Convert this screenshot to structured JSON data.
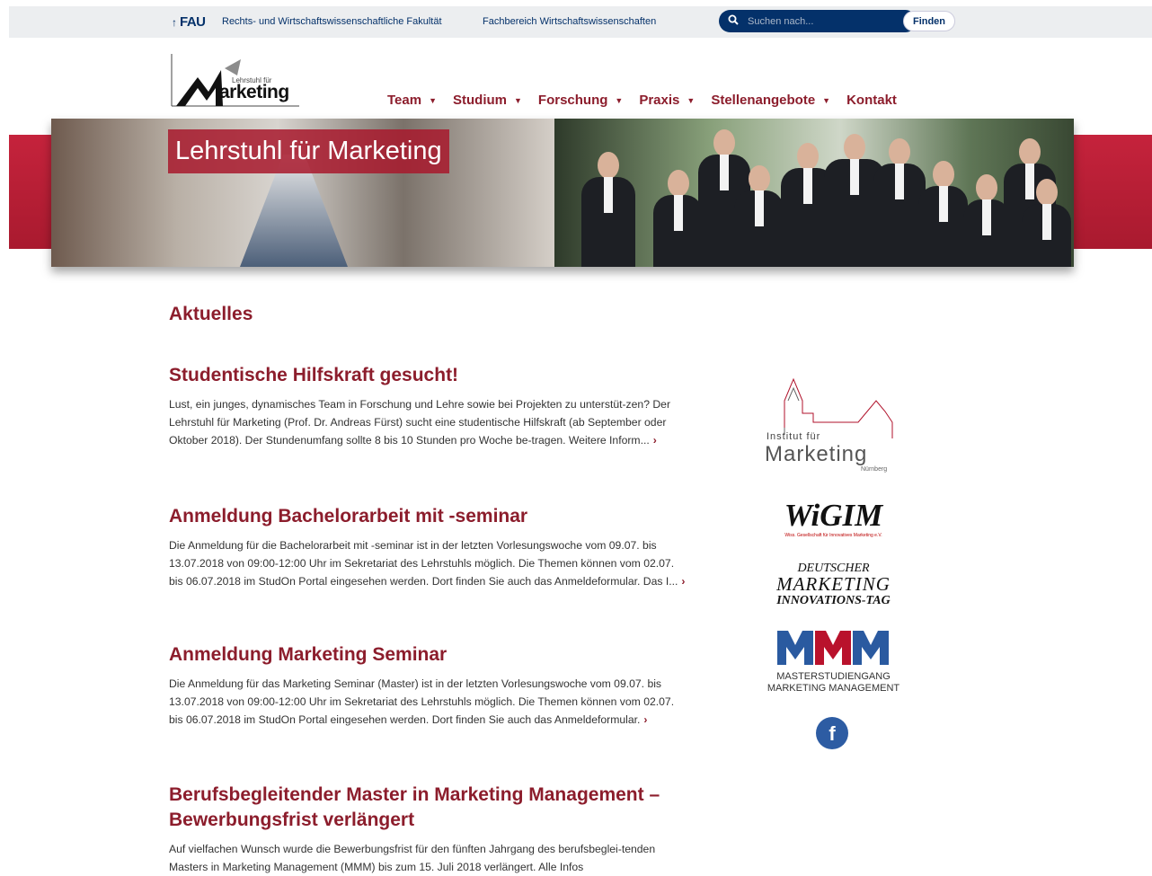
{
  "topbar": {
    "fau_arrow": "↑",
    "fau_label": "FAU",
    "crumb_faculty": "Rechts- und Wirtschaftswissenschaftliche Fakultät",
    "crumb_department": "Fachbereich Wirtschaftswissenschaften",
    "search_placeholder": "Suchen nach...",
    "search_button": "Finden"
  },
  "logo": {
    "line1": "Lehrstuhl für",
    "line2": "arketing"
  },
  "nav": {
    "items": [
      {
        "label": "Team",
        "dropdown": true
      },
      {
        "label": "Studium",
        "dropdown": true
      },
      {
        "label": "Forschung",
        "dropdown": true
      },
      {
        "label": "Praxis",
        "dropdown": true
      },
      {
        "label": "Stellenangebote",
        "dropdown": true
      },
      {
        "label": "Kontakt",
        "dropdown": false
      }
    ],
    "caret": "▼"
  },
  "hero": {
    "title": "Lehrstuhl für Marketing"
  },
  "main": {
    "section_title": "Aktuelles",
    "articles": [
      {
        "title": "Studentische Hilfskraft gesucht!",
        "text": "Lust, ein junges, dynamisches Team in Forschung und Lehre sowie bei Projekten zu unterstüt-zen? Der Lehrstuhl für Marketing (Prof. Dr. Andreas Fürst) sucht eine studentische Hilfskraft (ab September oder Oktober 2018). Der Stundenumfang sollte 8 bis 10 Stunden pro Woche be-tragen. Weitere Inform...",
        "more": "›"
      },
      {
        "title": "Anmeldung Bachelorarbeit mit -seminar",
        "text": "Die Anmeldung für die Bachelorarbeit mit -seminar ist in der letzten Vorlesungswoche vom 09.07. bis 13.07.2018 von 09:00-12:00 Uhr im Sekretariat des Lehrstuhls möglich. Die Themen können vom 02.07. bis 06.07.2018 im StudOn Portal eingesehen werden. Dort finden Sie auch das Anmeldeformular. Das I...",
        "more": "›"
      },
      {
        "title": "Anmeldung Marketing Seminar",
        "text": "Die Anmeldung für das Marketing Seminar (Master) ist in der letzten Vorlesungswoche vom 09.07. bis 13.07.2018 von 09:00-12:00 Uhr im Sekretariat des Lehrstuhls möglich. Die Themen können vom 02.07. bis 06.07.2018 im StudOn Portal eingesehen werden. Dort finden Sie auch das Anmeldeformular.",
        "more": "›"
      },
      {
        "title": "Berufsbegleitender Master in Marketing Management – Bewerbungsfrist verlängert",
        "text": "Auf vielfachen Wunsch wurde die Bewerbungsfrist für den fünften Jahrgang des berufsbeglei-tenden Masters in Marketing Management (MMM) bis zum 15. Juli 2018 verlängert. Alle Infos",
        "more": ""
      }
    ]
  },
  "sidebar": {
    "institut": {
      "line1": "Institut für",
      "line2": "Marketing",
      "line3": "Nürnberg"
    },
    "wigim": {
      "name": "WiGIM",
      "sub": "Wiss. Gesellschaft für Innovatives Marketing e.V."
    },
    "dmit": {
      "line1": "DEUTSCHER",
      "line2": "MARKETING",
      "line3": "INNOVATIONS-TAG"
    },
    "mmm": {
      "logo": "MMM",
      "line1": "MASTERSTUDIENGANG",
      "line2": "MARKETING MANAGEMENT"
    },
    "facebook": "f"
  }
}
